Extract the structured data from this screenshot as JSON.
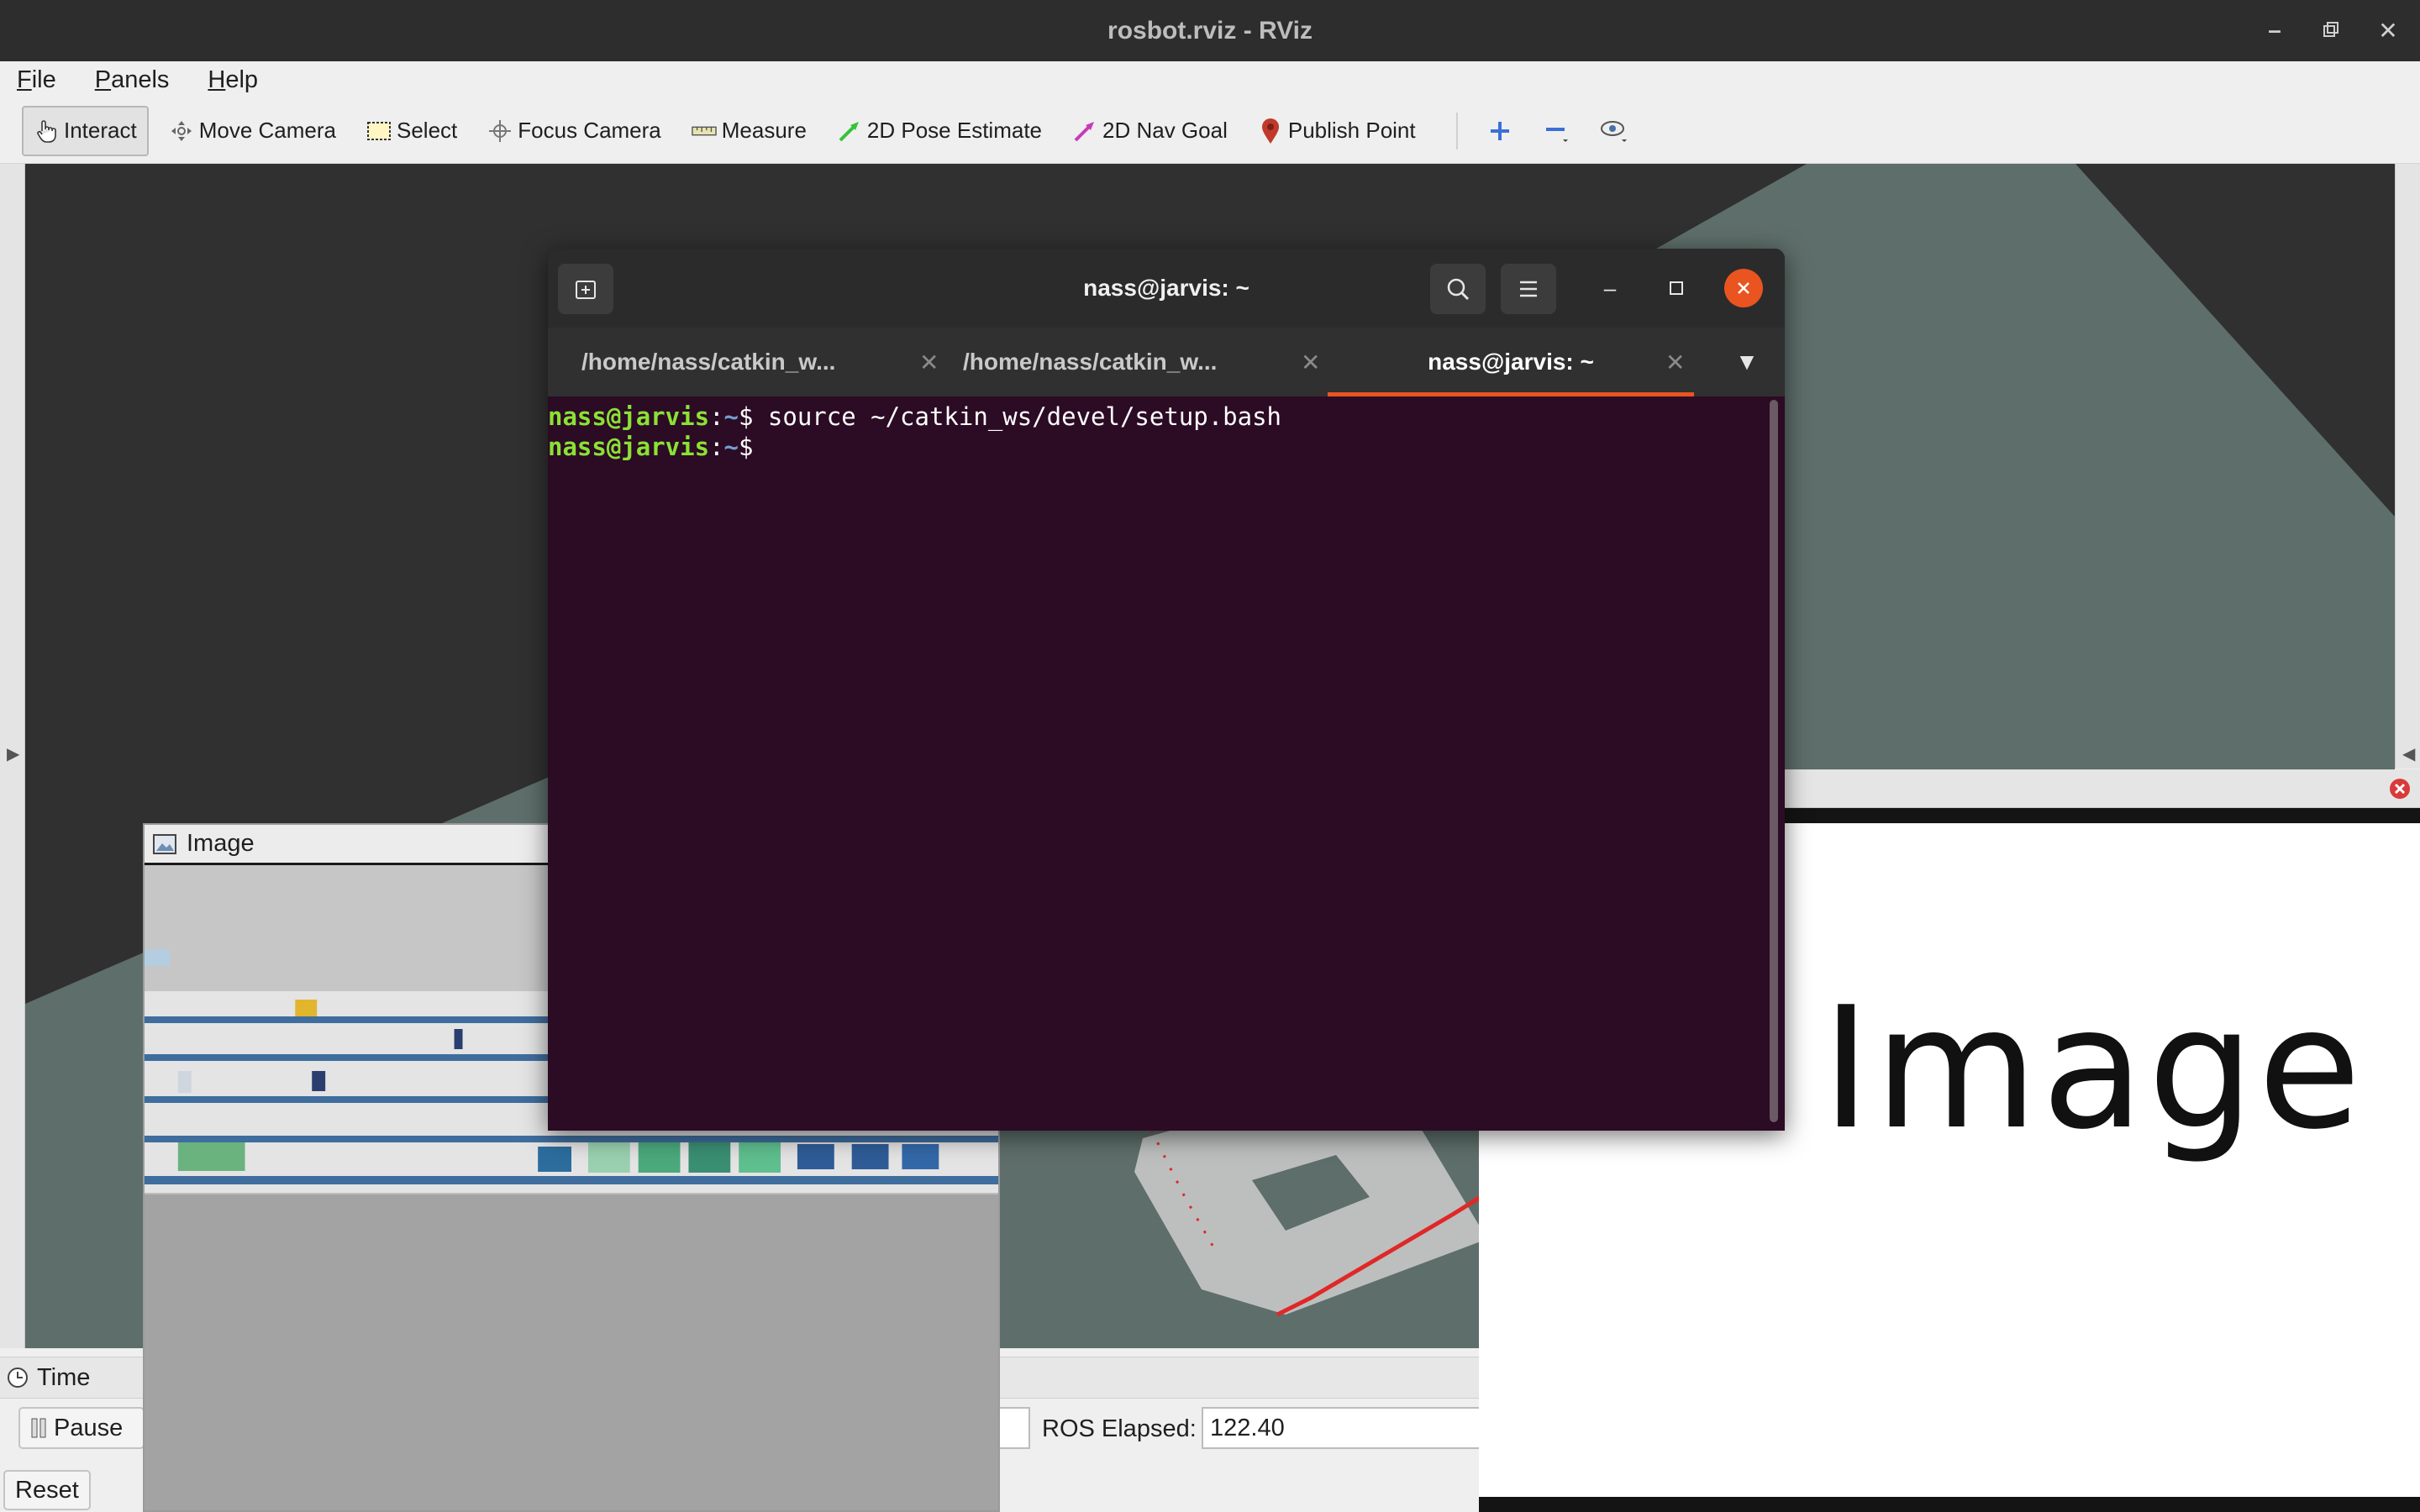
{
  "window": {
    "title": "rosbot.rviz - RViz",
    "controls": [
      "minimize",
      "restore",
      "close"
    ]
  },
  "menubar": {
    "items": [
      "File",
      "Panels",
      "Help"
    ]
  },
  "toolbar": {
    "tools": [
      {
        "label": "Interact",
        "icon": "hand-icon",
        "active": true
      },
      {
        "label": "Move Camera",
        "icon": "move-camera-icon",
        "active": false
      },
      {
        "label": "Select",
        "icon": "select-box-icon",
        "active": false
      },
      {
        "label": "Focus Camera",
        "icon": "focus-camera-icon",
        "active": false
      },
      {
        "label": "Measure",
        "icon": "ruler-icon",
        "active": false
      },
      {
        "label": "2D Pose Estimate",
        "icon": "pose-arrow-icon",
        "active": false
      },
      {
        "label": "2D Nav Goal",
        "icon": "nav-goal-arrow-icon",
        "active": false
      },
      {
        "label": "Publish Point",
        "icon": "map-pin-icon",
        "active": false
      }
    ],
    "extra_icons": [
      "add-tool-icon",
      "remove-tool-icon",
      "view-icon"
    ]
  },
  "time_panel": {
    "title": "Time",
    "pause_label": "Pause",
    "reset_label": "Reset",
    "ros_elapsed_label": "ROS Elapsed:",
    "ros_elapsed_value": "122.40"
  },
  "image_panel": {
    "title": "Image"
  },
  "no_image_panel": {
    "text": "No Image"
  },
  "terminal": {
    "title": "nass@jarvis: ~",
    "tabs": [
      {
        "label": "/home/nass/catkin_w...",
        "active": false
      },
      {
        "label": "/home/nass/catkin_w...",
        "active": false
      },
      {
        "label": "nass@jarvis: ~",
        "active": true
      }
    ],
    "lines": [
      {
        "user": "nass@jarvis",
        "sep": ":",
        "path": "~",
        "prompt": "$ ",
        "command": "source ~/catkin_ws/devel/setup.bash"
      },
      {
        "user": "nass@jarvis",
        "sep": ":",
        "path": "~",
        "prompt": "$",
        "command": ""
      }
    ]
  },
  "colors": {
    "terminal_bg": "#2c0b24",
    "prompt_user": "#8ae234",
    "prompt_path": "#729fcf",
    "tab_accent": "#e95420",
    "close_button": "#e95420",
    "viewport_bg": "#303030",
    "grid_floor": "#5e6e6a"
  }
}
